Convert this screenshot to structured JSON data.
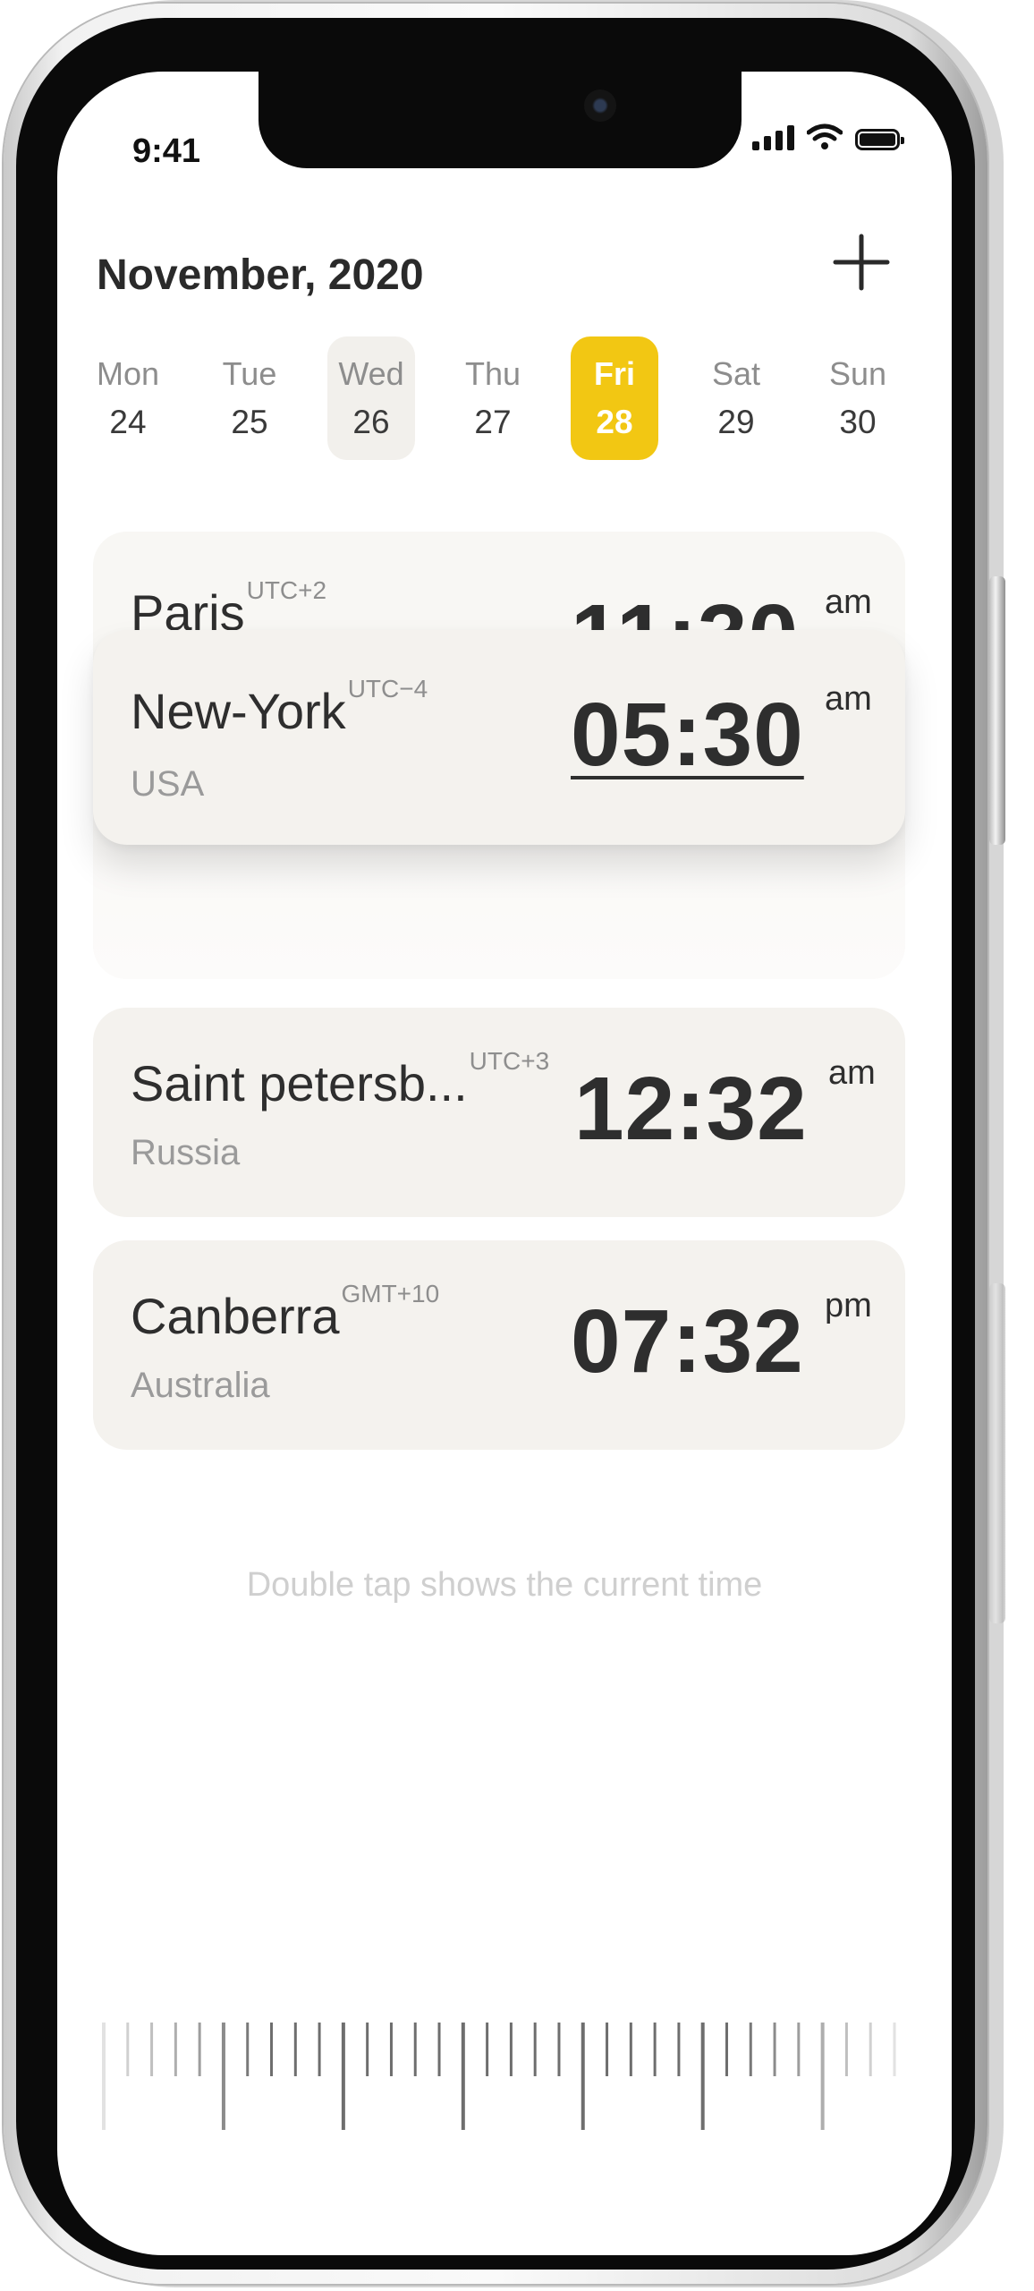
{
  "status_bar": {
    "time": "9:41"
  },
  "header": {
    "title": "November, 2020",
    "add_icon": "plus-icon"
  },
  "week": [
    {
      "day": "Mon",
      "date": "24",
      "state": "normal"
    },
    {
      "day": "Tue",
      "date": "25",
      "state": "normal"
    },
    {
      "day": "Wed",
      "date": "26",
      "state": "hover"
    },
    {
      "day": "Thu",
      "date": "27",
      "state": "normal"
    },
    {
      "day": "Fri",
      "date": "28",
      "state": "selected"
    },
    {
      "day": "Sat",
      "date": "29",
      "state": "normal"
    },
    {
      "day": "Sun",
      "date": "30",
      "state": "normal"
    }
  ],
  "cards": {
    "paris": {
      "city": "Paris",
      "utc": "UTC+2",
      "time": "11:30",
      "period": "am"
    },
    "newyork": {
      "city": "New-York",
      "utc": "UTC−4",
      "country": "USA",
      "time": "05:30",
      "period": "am"
    },
    "spb": {
      "city": "Saint petersb...",
      "utc": "UTC+3",
      "country": "Russia",
      "time": "12:32",
      "period": "am"
    },
    "canberra": {
      "city": "Canberra",
      "utc": "GMT+10",
      "country": "Australia",
      "time": "07:32",
      "period": "pm"
    }
  },
  "hint": "Double tap shows the current time",
  "colors": {
    "accent": "#f2c713",
    "card_bg": "#f4f2ee",
    "text": "#2e2e2e",
    "muted": "#9a9a9a"
  }
}
